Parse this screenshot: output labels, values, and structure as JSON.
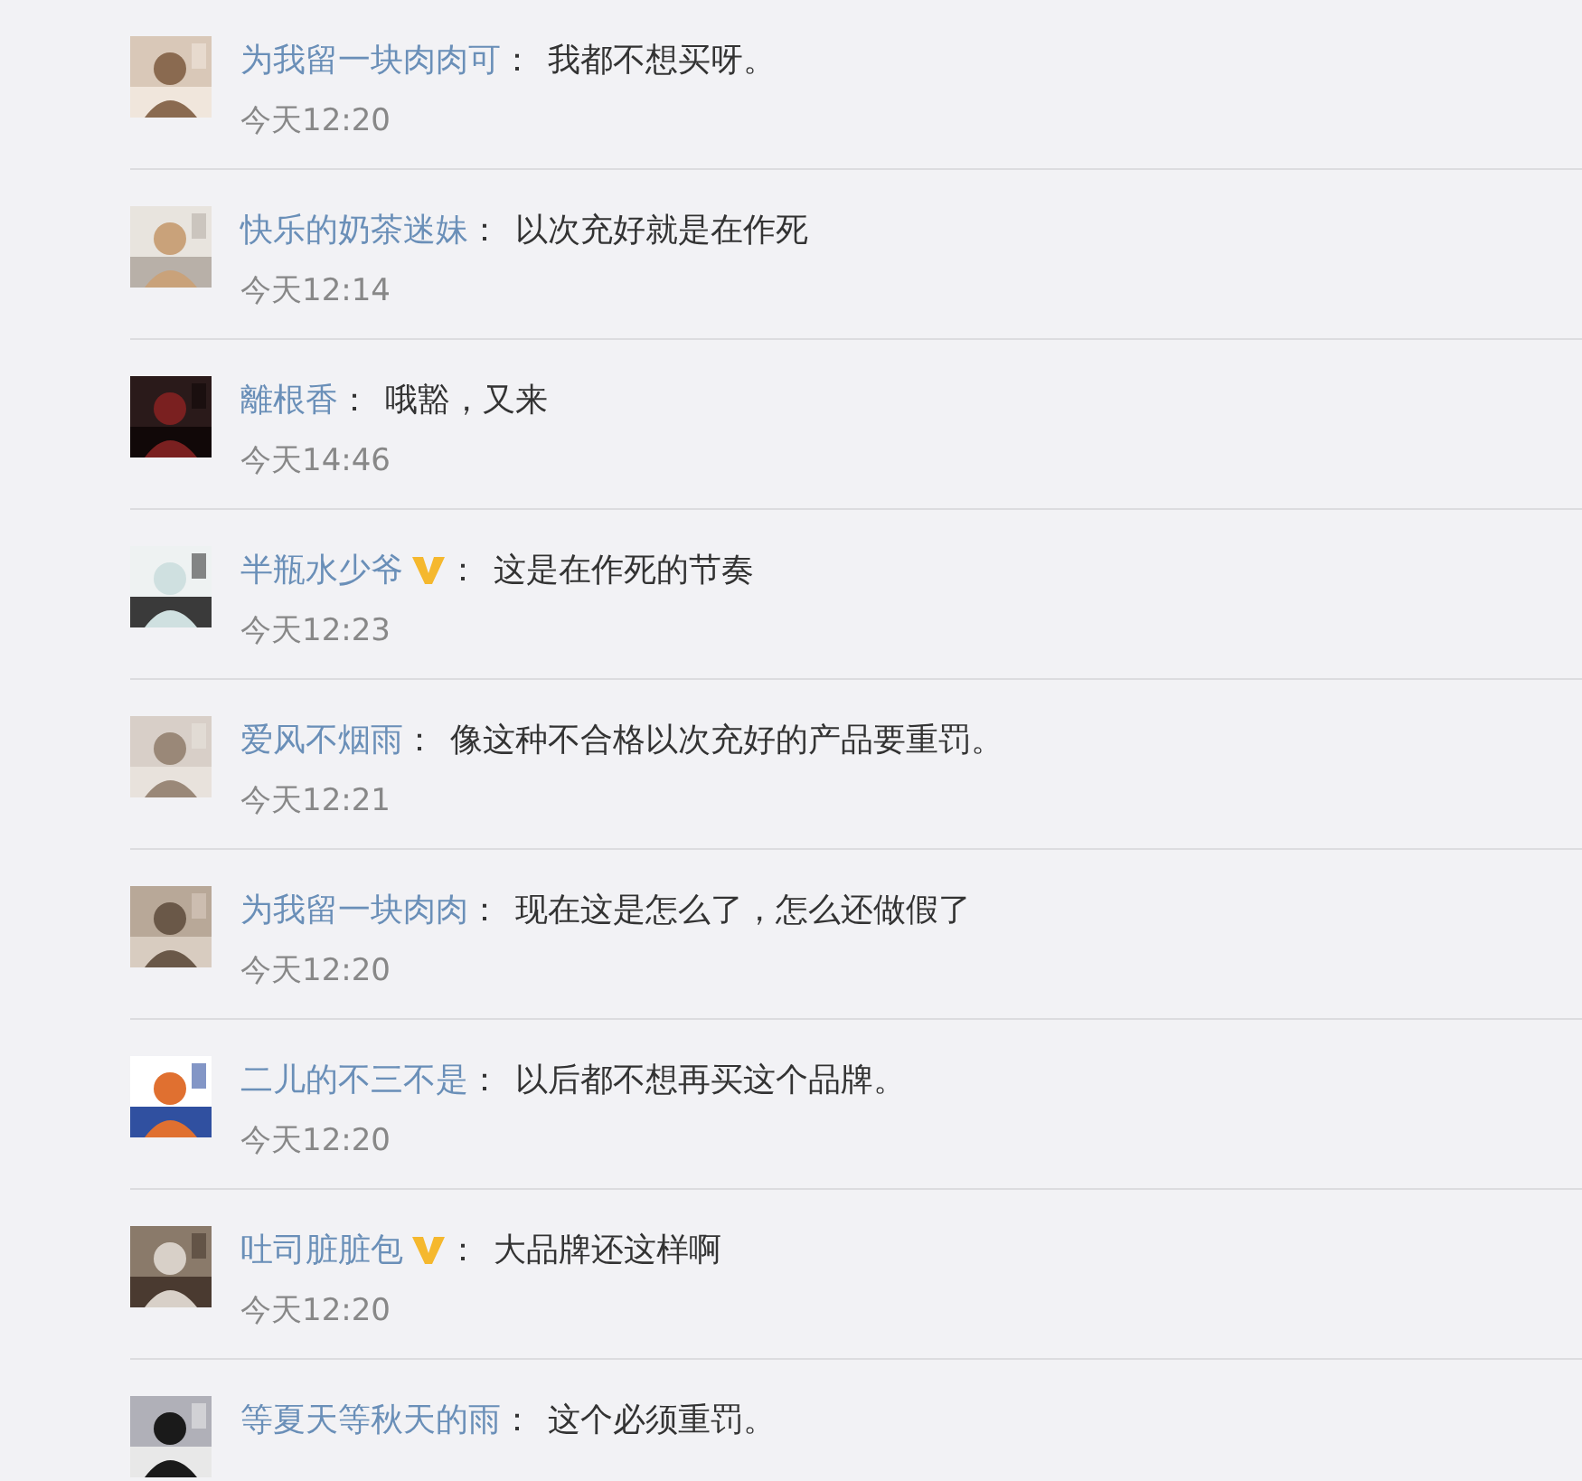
{
  "comments": [
    {
      "user": "为我留一块肉肉可",
      "verified": false,
      "colon": "：",
      "text": "我都不想买呀。",
      "time": "今天12:20"
    },
    {
      "user": "快乐的奶茶迷妹",
      "verified": false,
      "colon": "：",
      "text": "以次充好就是在作死",
      "time": "今天12:14"
    },
    {
      "user": "離根香",
      "verified": false,
      "colon": "：",
      "text": "哦豁，又来",
      "time": "今天14:46"
    },
    {
      "user": "半瓶水少爷",
      "verified": true,
      "colon": "：",
      "text": "这是在作死的节奏",
      "time": "今天12:23"
    },
    {
      "user": "爱风不烟雨",
      "verified": false,
      "colon": "：",
      "text": "像这种不合格以次充好的产品要重罚。",
      "time": "今天12:21"
    },
    {
      "user": "为我留一块肉肉",
      "verified": false,
      "colon": "：",
      "text": "现在这是怎么了，怎么还做假了",
      "time": "今天12:20"
    },
    {
      "user": "二儿的不三不是",
      "verified": false,
      "colon": "：",
      "text": "以后都不想再买这个品牌。",
      "time": "今天12:20"
    },
    {
      "user": "吐司脏脏包",
      "verified": true,
      "colon": "：",
      "text": "大品牌还这样啊",
      "time": "今天12:20"
    },
    {
      "user": "等夏天等秋天的雨",
      "verified": false,
      "colon": "：",
      "text": "这个必须重罚。"
    }
  ]
}
